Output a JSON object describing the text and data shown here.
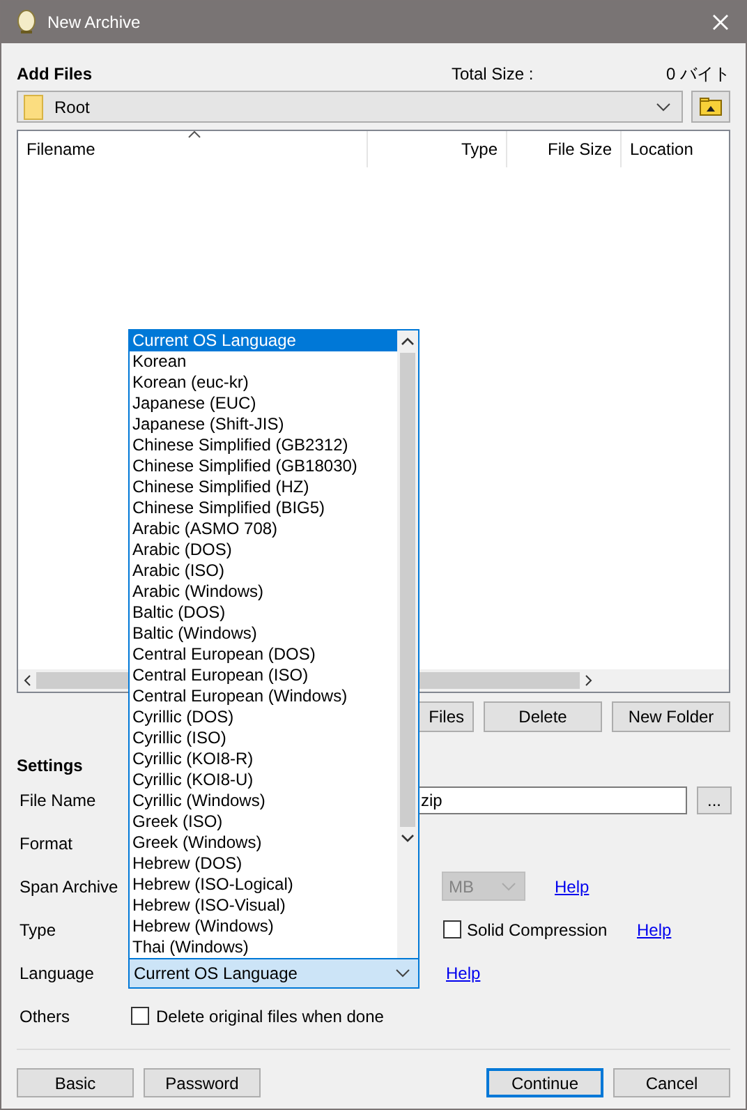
{
  "window": {
    "title": "New Archive"
  },
  "add_files": {
    "heading": "Add Files",
    "total_size_label": "Total Size :",
    "total_size": "0 バイト",
    "folder": "Root"
  },
  "file_list": {
    "columns": [
      "Filename",
      "Type",
      "File Size",
      "Location"
    ]
  },
  "file_buttons": [
    "Files",
    "Delete",
    "New Folder"
  ],
  "settings": {
    "heading": "Settings",
    "rows": [
      {
        "label": "File Name",
        "kind": "filename",
        "value": "zip",
        "browse": "..."
      },
      {
        "label": "Format",
        "kind": "blank"
      },
      {
        "label": "Span Archive",
        "kind": "span",
        "unit": "MB",
        "disabled": true,
        "help": "Help"
      },
      {
        "label": "Type",
        "kind": "type",
        "checkbox_label": "Solid Compression",
        "checked": false,
        "help": "Help"
      },
      {
        "label": "Language",
        "kind": "language",
        "value": "Current OS Language",
        "help": "Help"
      },
      {
        "label": "Others",
        "kind": "others",
        "checkbox_label": "Delete original files when done",
        "checked": false
      }
    ]
  },
  "language_dropdown": {
    "options": [
      {
        "label": "Current OS Language",
        "selected": true
      },
      {
        "label": "Korean",
        "selected": false
      },
      {
        "label": "Korean (euc-kr)",
        "selected": false
      },
      {
        "label": "Japanese (EUC)",
        "selected": false
      },
      {
        "label": "Japanese (Shift-JIS)",
        "selected": false
      },
      {
        "label": "Chinese Simplified (GB2312)",
        "selected": false
      },
      {
        "label": "Chinese Simplified (GB18030)",
        "selected": false
      },
      {
        "label": "Chinese Simplified (HZ)",
        "selected": false
      },
      {
        "label": "Chinese Simplified (BIG5)",
        "selected": false
      },
      {
        "label": "Arabic (ASMO 708)",
        "selected": false
      },
      {
        "label": "Arabic (DOS)",
        "selected": false
      },
      {
        "label": "Arabic (ISO)",
        "selected": false
      },
      {
        "label": "Arabic (Windows)",
        "selected": false
      },
      {
        "label": "Baltic (DOS)",
        "selected": false
      },
      {
        "label": "Baltic (Windows)",
        "selected": false
      },
      {
        "label": "Central European (DOS)",
        "selected": false
      },
      {
        "label": "Central European (ISO)",
        "selected": false
      },
      {
        "label": "Central European (Windows)",
        "selected": false
      },
      {
        "label": "Cyrillic (DOS)",
        "selected": false
      },
      {
        "label": "Cyrillic (ISO)",
        "selected": false
      },
      {
        "label": "Cyrillic (KOI8-R)",
        "selected": false
      },
      {
        "label": "Cyrillic (KOI8-U)",
        "selected": false
      },
      {
        "label": "Cyrillic (Windows)",
        "selected": false
      },
      {
        "label": "Greek (ISO)",
        "selected": false
      },
      {
        "label": "Greek (Windows)",
        "selected": false
      },
      {
        "label": "Hebrew (DOS)",
        "selected": false
      },
      {
        "label": "Hebrew (ISO-Logical)",
        "selected": false
      },
      {
        "label": "Hebrew (ISO-Visual)",
        "selected": false
      },
      {
        "label": "Hebrew (Windows)",
        "selected": false
      },
      {
        "label": "Thai (Windows)",
        "selected": false
      }
    ]
  },
  "footer_buttons": [
    {
      "label": "Basic",
      "default": false
    },
    {
      "label": "Password",
      "default": false
    },
    {
      "label": "Continue",
      "default": true
    },
    {
      "label": "Cancel",
      "default": false
    }
  ]
}
